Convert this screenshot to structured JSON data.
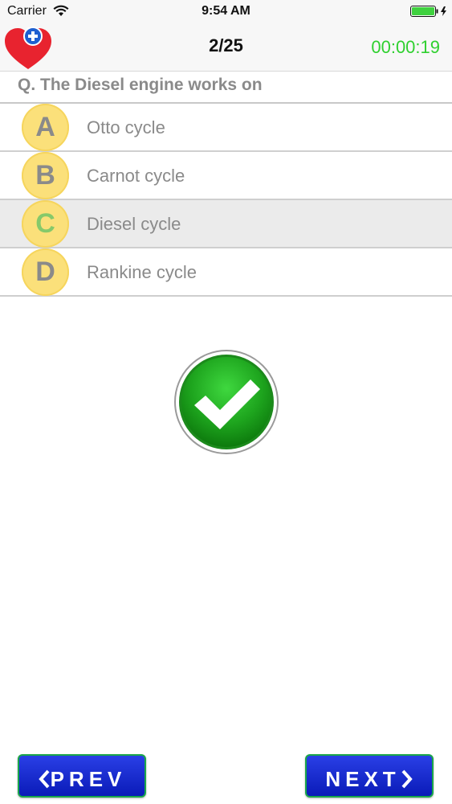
{
  "status_bar": {
    "carrier": "Carrier",
    "time": "9:54 AM"
  },
  "nav": {
    "counter": "2/25",
    "timer": "00:00:19"
  },
  "question": {
    "text": "Q. The Diesel engine works on"
  },
  "options": [
    {
      "letter": "A",
      "text": "Otto cycle"
    },
    {
      "letter": "B",
      "text": "Carnot cycle"
    },
    {
      "letter": "C",
      "text": "Diesel cycle"
    },
    {
      "letter": "D",
      "text": "Rankine cycle"
    }
  ],
  "result": {
    "icon": "checkmark-icon",
    "color": "#1ea51e"
  },
  "buttons": {
    "prev_label": "PREV",
    "next_label": "NEXT"
  },
  "colors": {
    "timer": "#2fd02f",
    "badge": "#fbe07a",
    "button": "#1a2fd6"
  }
}
